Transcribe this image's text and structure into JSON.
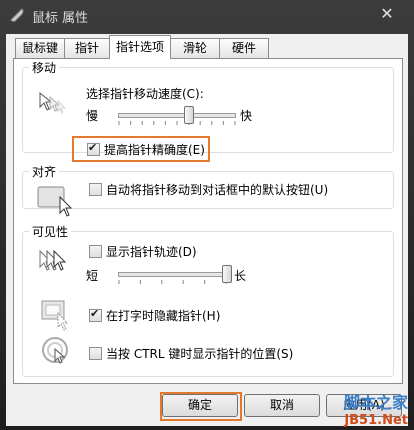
{
  "window": {
    "title": "鼠标 属性",
    "close_glyph": "✕"
  },
  "tabs": [
    {
      "label": "鼠标键",
      "active": false
    },
    {
      "label": "指针",
      "active": false
    },
    {
      "label": "指针选项",
      "active": true
    },
    {
      "label": "滑轮",
      "active": false
    },
    {
      "label": "硬件",
      "active": false
    }
  ],
  "motion": {
    "legend": "移动",
    "speed_label": "选择指针移动速度(C):",
    "slow": "慢",
    "fast": "快",
    "speed_value": 0.6,
    "precision_label": "提高指针精确度(E)",
    "precision_checked": true
  },
  "snap": {
    "legend": "对齐",
    "snap_label": "自动将指针移动到对话框中的默认按钮(U)",
    "snap_checked": false
  },
  "visibility": {
    "legend": "可见性",
    "trails_label": "显示指针轨迹(D)",
    "trails_checked": false,
    "short": "短",
    "long": "长",
    "trail_value": 1.0,
    "hide_label": "在打字时隐藏指针(H)",
    "hide_checked": true,
    "ctrl_label": "当按 CTRL 键时显示指针的位置(S)",
    "ctrl_checked": false
  },
  "buttons": {
    "ok": "确定",
    "cancel": "取消",
    "apply": "应用(A)"
  },
  "watermark": {
    "line1": "脚本之家",
    "line2": "JB51.Net"
  },
  "colors": {
    "highlight": "#e2792c",
    "titlebar": "#2a2a2a",
    "panel": "#ffffff"
  },
  "icons": [
    "mouse-app-icon",
    "close-icon",
    "pointer-speed-icon",
    "snap-icon",
    "trails-icon",
    "hide-typing-icon",
    "ctrl-locate-icon"
  ]
}
